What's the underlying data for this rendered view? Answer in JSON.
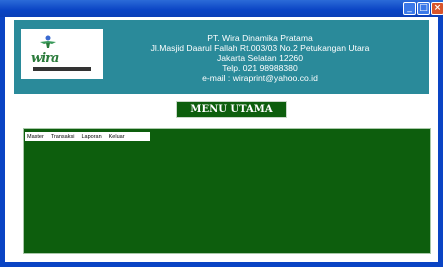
{
  "window": {
    "controls": {
      "minimize_icon": "minimize-icon",
      "maximize_icon": "maximize-icon",
      "close_icon": "close-icon"
    }
  },
  "header": {
    "logo_text": "wira",
    "company_lines": [
      "PT. Wira Dinamika Pratama",
      "Jl.Masjid Daarul Fallah Rt.003/03 No.2 Petukangan Utara",
      "Jakarta Selatan 12260",
      "Telp. 021 98988380",
      "e-mail : wiraprint@yahoo.co.id"
    ]
  },
  "menu_title": "MENU UTAMA",
  "menubar": {
    "items": [
      "Master",
      "Transaksi",
      "Laporan",
      "Keluar"
    ]
  },
  "colors": {
    "titlebar": "#0a44c4",
    "header_bg": "#2a8a9a",
    "panel_bg": "#0d5e0d",
    "close_button": "#d9542a"
  }
}
